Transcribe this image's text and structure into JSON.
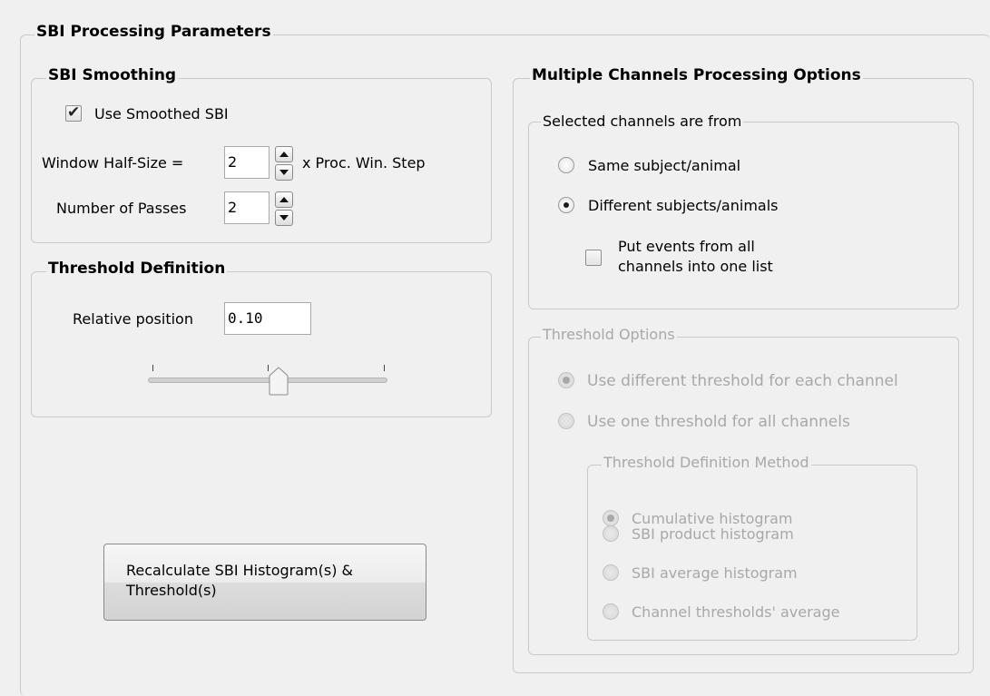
{
  "outer": {
    "title": "SBI Processing Parameters"
  },
  "smoothing": {
    "title": "SBI Smoothing",
    "use_smoothed_label": "Use Smoothed SBI",
    "use_smoothed_checked": true,
    "window_label": "Window Half-Size =",
    "window_value": "2",
    "window_suffix": "x Proc. Win. Step",
    "passes_label": "Number of  Passes",
    "passes_value": "2"
  },
  "threshold_def": {
    "title": "Threshold Definition",
    "relative_label": "Relative position",
    "relative_value": "0.10",
    "slider_position": 0.5
  },
  "recalc_button": {
    "line1": "Recalculate SBI Histogram(s) &",
    "line2": "Threshold(s)"
  },
  "multi": {
    "title": "Multiple Channels Processing Options",
    "selected_from": {
      "title": "Selected channels are from",
      "same_label": "Same subject/animal",
      "different_label": "Different subjects/animals",
      "selected": "different",
      "put_events_line1": "Put events from all",
      "put_events_line2": "channels into one list",
      "put_events_checked": false
    },
    "threshold_options": {
      "title": "Threshold Options",
      "different_label": "Use different threshold for each channel",
      "one_label": "Use one threshold for all channels",
      "selected": "different",
      "method": {
        "title": "Threshold Definition Method",
        "options": [
          "Cumulative histogram",
          "SBI product histogram",
          "SBI average histogram",
          "Channel thresholds' average"
        ],
        "selected_index": 0
      }
    }
  }
}
